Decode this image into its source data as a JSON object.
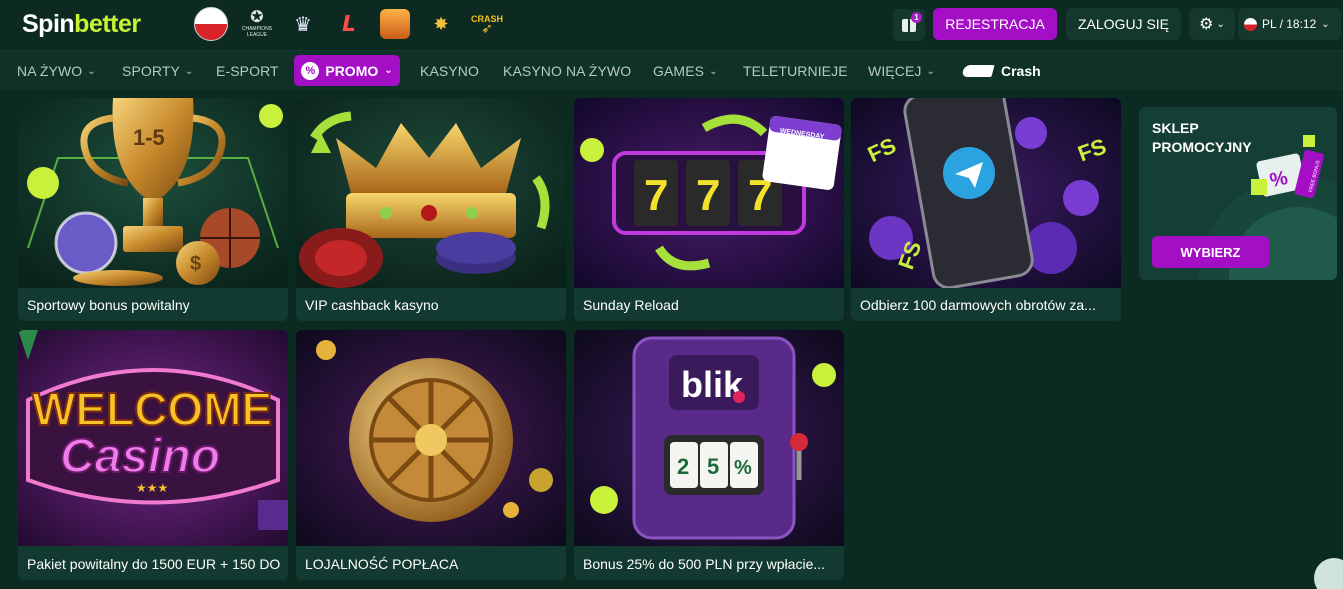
{
  "brand": {
    "spin": "Spin",
    "better": "better"
  },
  "quick_links": [
    {
      "name": "poland-flag"
    },
    {
      "name": "champions-league",
      "label": "CHAMPIONS LEAGUE"
    },
    {
      "name": "premier-league"
    },
    {
      "name": "laliga"
    },
    {
      "name": "badge"
    },
    {
      "name": "rooster"
    },
    {
      "name": "crash",
      "label": "CRASH"
    }
  ],
  "header": {
    "gift_count": "1",
    "register": "REJESTRACJA",
    "login": "ZALOGUJ SIĘ",
    "lang": "PL / 18:12"
  },
  "nav": [
    {
      "label": "NA ŻYWO",
      "dropdown": true
    },
    {
      "label": "SPORTY",
      "dropdown": true
    },
    {
      "label": "E-SPORT",
      "dropdown": false
    },
    {
      "label": "PROMO",
      "dropdown": true,
      "active": true
    },
    {
      "label": "KASYNO",
      "dropdown": false
    },
    {
      "label": "KASYNO NA ŻYWO",
      "dropdown": false
    },
    {
      "label": "GAMES",
      "dropdown": true
    },
    {
      "label": "TELETURNIEJE",
      "dropdown": false
    },
    {
      "label": "WIĘCEJ",
      "dropdown": true
    },
    {
      "label": "Crash",
      "dropdown": false
    }
  ],
  "promos": [
    {
      "title": "Sportowy bonus powitalny",
      "art_text": "1-5"
    },
    {
      "title": "VIP cashback kasyno"
    },
    {
      "title": "Sunday Reload",
      "art_text": "777",
      "badge": "WEDNESDAY"
    },
    {
      "title": "Odbierz 100 darmowych obrotów za...",
      "art_text": "FS"
    },
    {
      "title": "Pakiet powitalny do 1500 EUR + 150 DO",
      "art_text_1": "WELCOME",
      "art_text_2": "Casino"
    },
    {
      "title": "LOJALNOŚĆ POPŁACA"
    },
    {
      "title": "Bonus 25% do 500 PLN przy wpłacie...",
      "art_text": "blik",
      "reels": [
        "2",
        "5",
        "%"
      ]
    }
  ],
  "shop": {
    "title": "SKLEP PROMOCYJNY",
    "button": "WYBIERZ",
    "tag_text": "FREE BONUS"
  },
  "colors": {
    "accent": "#a40fc6",
    "lime": "#c6f432",
    "bg": "#0b2a22",
    "card": "#133a30"
  }
}
